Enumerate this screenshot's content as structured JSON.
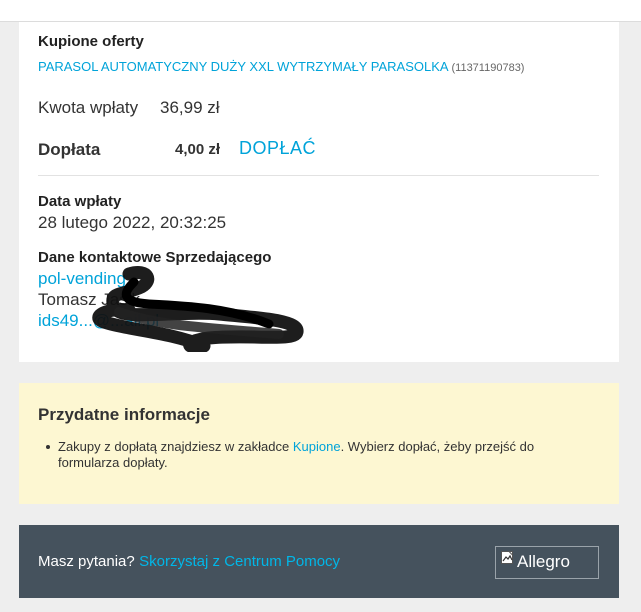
{
  "purchased": {
    "heading": "Kupione oferty",
    "product_name": "PARASOL AUTOMATYCZNY DUŻY XXL WYTRZYMAŁY PARASOLKA",
    "offer_id": "(11371190783)"
  },
  "payment": {
    "amount_label": "Kwota wpłaty",
    "amount_value": "36,99 zł",
    "topay_label": "Dopłata",
    "topay_value": "4,00 zł",
    "topay_button": "DOPŁAĆ"
  },
  "date": {
    "label": "Data wpłaty",
    "value": "28 lutego 2022, 20:32:25"
  },
  "seller": {
    "heading": "Dane kontaktowe Sprzedającego",
    "login": "pol-vending",
    "name": "Tomasz Jasik",
    "email": "ids49...@...ail.pl"
  },
  "info": {
    "title": "Przydatne informacje",
    "text_before": "Zakupy z dopłatą znajdziesz w zakładce ",
    "text_link": "Kupione",
    "text_after": ". Wybierz dopłać, żeby przejść do formularza dopłaty."
  },
  "footer": {
    "question": "Masz pytania?",
    "help_link": "Skorzystaj z Centrum Pomocy",
    "logo_alt": "Allegro"
  },
  "colors": {
    "accent": "#00a3d9",
    "info_bg": "#fdf7d2",
    "footer_bg": "#45525d"
  }
}
